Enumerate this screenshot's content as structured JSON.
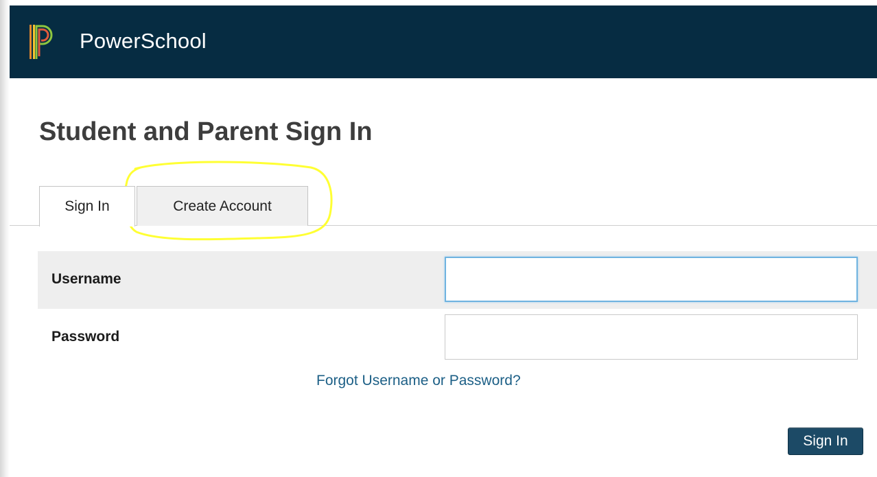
{
  "header": {
    "brand_name": "PowerSchool",
    "logo_icon": "powerschool-logo-icon",
    "background_color": "#062c42"
  },
  "page": {
    "title": "Student and Parent Sign In"
  },
  "tabs": [
    {
      "label": "Sign In",
      "active": true
    },
    {
      "label": "Create Account",
      "active": false,
      "highlighted": true
    }
  ],
  "form": {
    "username_label": "Username",
    "username_value": "",
    "password_label": "Password",
    "password_value": "",
    "forgot_link": "Forgot Username or Password?",
    "submit_label": "Sign In"
  },
  "colors": {
    "highlight": "#ffff33",
    "link": "#1c5f86",
    "button": "#1c4a66"
  }
}
